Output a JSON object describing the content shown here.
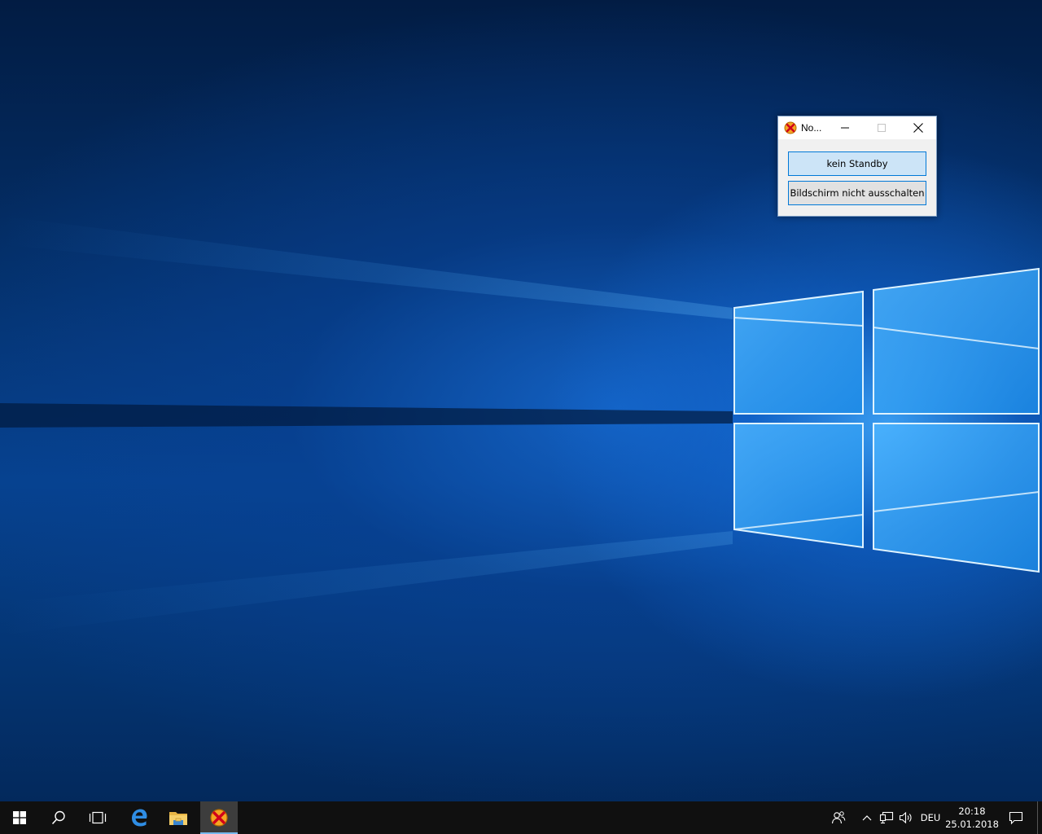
{
  "window": {
    "title": "No...",
    "buttons": {
      "no_standby": "kein Standby",
      "no_screen_off": "Bildschirm nicht ausschalten"
    },
    "controls": [
      "minimize-icon",
      "maximize-icon",
      "close-icon"
    ]
  },
  "taskbar": {
    "items": [
      "windows-start-icon",
      "search-icon",
      "task-view-icon",
      "edge-icon",
      "file-explorer-icon",
      "app-icon"
    ],
    "tray": {
      "language": "DEU",
      "time": "20:18",
      "date": "25.01.2018",
      "icons": [
        "people-icon",
        "chevron-up-icon",
        "network-icon",
        "volume-icon",
        "action-center-icon"
      ]
    }
  },
  "colors": {
    "accent": "#0078d7",
    "taskbar": "#101010",
    "active_indicator": "#76b9ed"
  }
}
